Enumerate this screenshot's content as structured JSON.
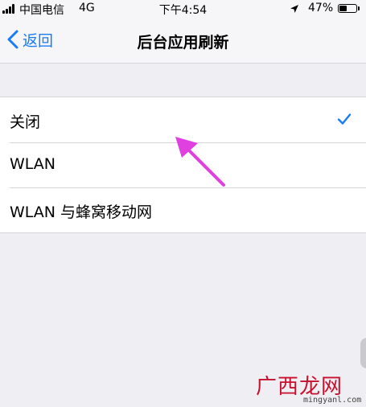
{
  "status_bar": {
    "carrier": "中国电信",
    "network": "4G",
    "time": "下午4:54",
    "battery_percent": "47%",
    "battery_level": 0.47
  },
  "nav": {
    "back_label": "返回",
    "title": "后台应用刷新"
  },
  "options": [
    {
      "label": "关闭",
      "selected": true
    },
    {
      "label": "WLAN",
      "selected": false
    },
    {
      "label": "WLAN 与蜂窝移动网",
      "selected": false
    }
  ],
  "colors": {
    "accent": "#1a7cf5",
    "annotation": "#e040e0",
    "watermark": "#c8102e"
  },
  "watermark": {
    "logo_text": "广西龙网",
    "url": "mingyanl.com"
  }
}
